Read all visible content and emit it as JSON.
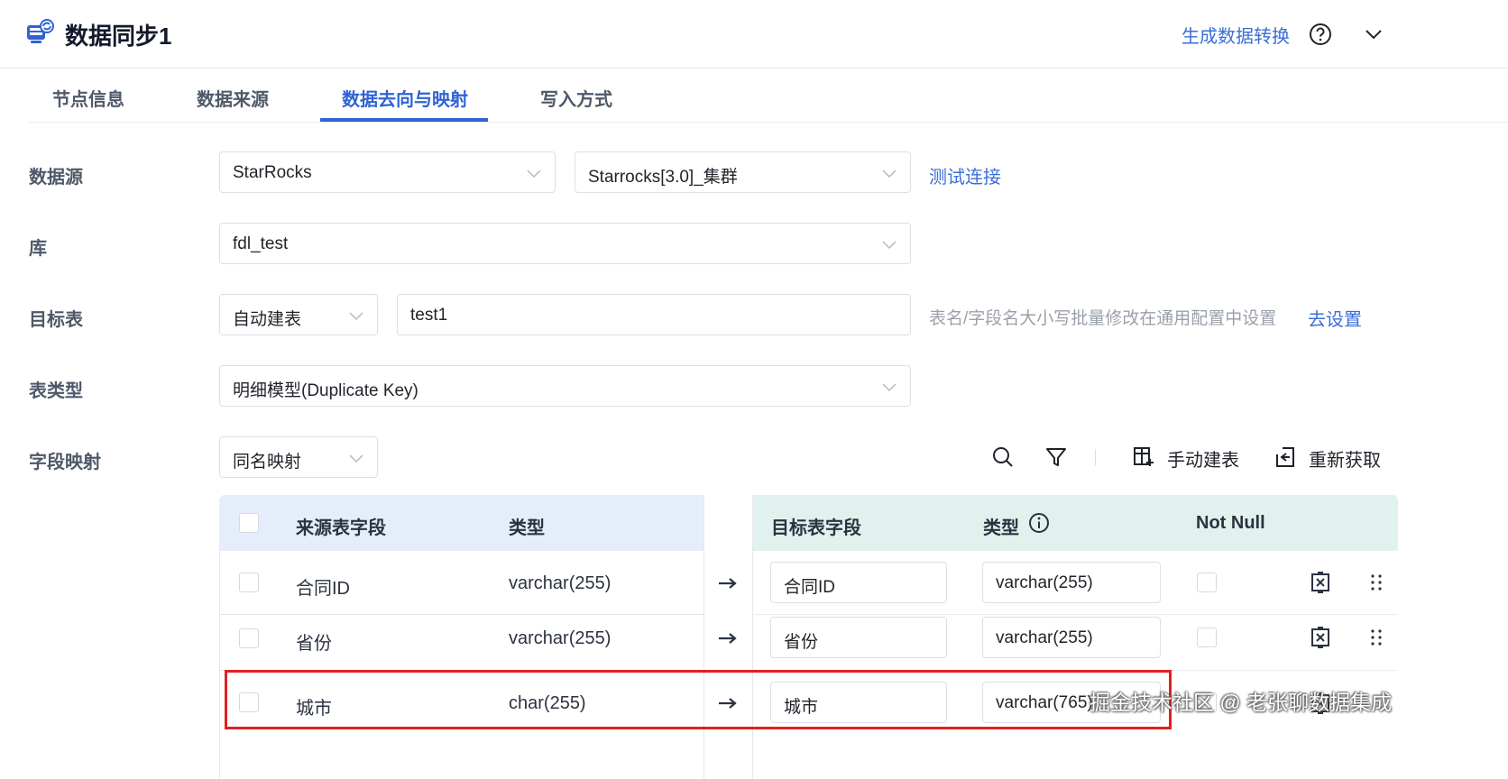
{
  "header": {
    "title": "数据同步1",
    "action_link": "生成数据转换",
    "app_icon": "sync-app-icon",
    "help_icon": "question-circle-icon",
    "collapse_icon": "chevron-down-icon"
  },
  "tabs": [
    {
      "label": "节点信息",
      "active": false
    },
    {
      "label": "数据来源",
      "active": false
    },
    {
      "label": "数据去向与映射",
      "active": true
    },
    {
      "label": "写入方式",
      "active": false
    }
  ],
  "form": {
    "datasource": {
      "label": "数据源",
      "type_value": "StarRocks",
      "connection_value": "Starrocks[3.0]_集群",
      "test_link": "测试连接"
    },
    "database": {
      "label": "库",
      "value": "fdl_test"
    },
    "target_table": {
      "label": "目标表",
      "mode_value": "自动建表",
      "table_name": "test1",
      "hint": "表名/字段名大小写批量修改在通用配置中设置",
      "settings_link": "去设置"
    },
    "table_type": {
      "label": "表类型",
      "value": "明细模型(Duplicate Key)"
    },
    "field_mapping": {
      "label": "字段映射",
      "value": "同名映射"
    }
  },
  "toolbar": {
    "manual_create_label": "手动建表",
    "refresh_label": "重新获取"
  },
  "table": {
    "source_headers": {
      "field": "来源表字段",
      "type": "类型"
    },
    "target_headers": {
      "field": "目标表字段",
      "type": "类型",
      "not_null": "Not Null"
    },
    "rows": [
      {
        "source_field": "合同ID",
        "source_type": "varchar(255)",
        "target_field": "合同ID",
        "target_type": "varchar(255)"
      },
      {
        "source_field": "省份",
        "source_type": "varchar(255)",
        "target_field": "省份",
        "target_type": "varchar(255)"
      },
      {
        "source_field": "城市",
        "source_type": "char(255)",
        "target_field": "城市",
        "target_type": "varchar(765)"
      }
    ]
  },
  "watermark": "掘金技术社区 @ 老张聊数据集成",
  "colors": {
    "accent": "#2f63d4",
    "link": "#3b6ed6",
    "highlight": "#e02020",
    "source_header_bg": "#e6edfa",
    "target_header_bg": "#e1f2ee"
  }
}
